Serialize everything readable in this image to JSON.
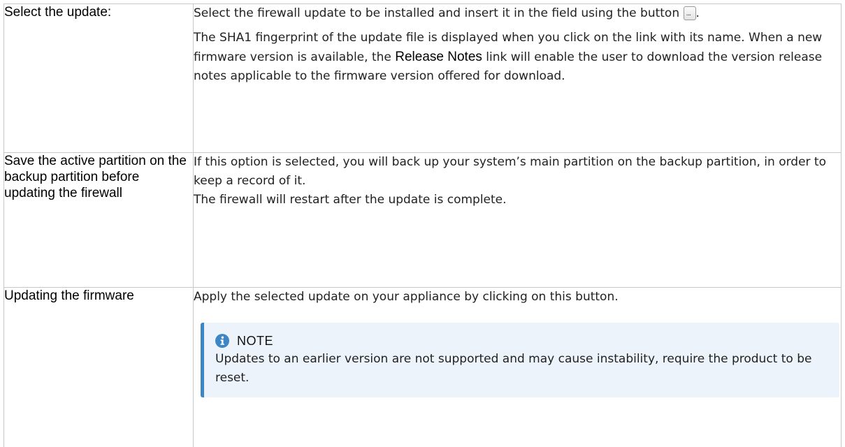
{
  "rows": [
    {
      "term": "Select the update:",
      "desc1_before_button": "Select the firewall update to be installed and insert it in the field using the button",
      "button_dots": "...",
      "desc1_after_button": ".",
      "desc2_part1": "The SHA1 fingerprint of the update file is displayed when you click on the link with its name. When a new firmware version is available, the",
      "desc2_bold": "Release Notes",
      "desc2_part2": "link will enable the user to download the version release notes applicable to the firmware version offered for download."
    },
    {
      "term": "Save the active partition on the backup partition before updating the firewall",
      "line1": "If this option is selected, you will back up your system’s main partition on the backup partition, in order to keep a record of it.",
      "line2": "The firewall will restart after the update is complete."
    },
    {
      "term": "Updating the firmware",
      "desc": "Apply the selected update on your appliance by clicking on this button.",
      "note": {
        "title": "NOTE",
        "text": "Updates to an earlier version are not supported and may cause instability, require the product to be reset.",
        "icon": "info-circle-icon",
        "accent_color": "#3d86c6",
        "background_color": "#edf3fb"
      }
    }
  ]
}
